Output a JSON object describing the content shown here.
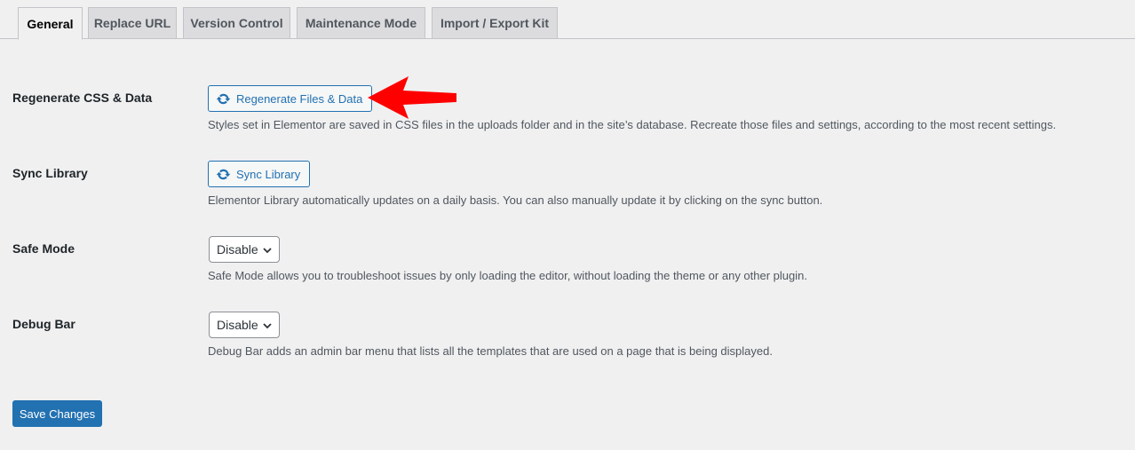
{
  "tabs": [
    {
      "label": "General",
      "active": true
    },
    {
      "label": "Replace URL"
    },
    {
      "label": "Version Control"
    },
    {
      "label": "Maintenance Mode"
    },
    {
      "label": "Import / Export Kit"
    }
  ],
  "settings": {
    "regenerate": {
      "label": "Regenerate CSS & Data",
      "button": "Regenerate Files & Data",
      "icon": "refresh-icon",
      "description": "Styles set in Elementor are saved in CSS files in the uploads folder and in the site’s database. Recreate those files and settings, according to the most recent settings."
    },
    "sync": {
      "label": "Sync Library",
      "button": "Sync Library",
      "icon": "refresh-icon",
      "description": "Elementor Library automatically updates on a daily basis. You can also manually update it by clicking on the sync button."
    },
    "safe_mode": {
      "label": "Safe Mode",
      "value": "Disable",
      "description": "Safe Mode allows you to troubleshoot issues by only loading the editor, without loading the theme or any other plugin."
    },
    "debug_bar": {
      "label": "Debug Bar",
      "value": "Disable",
      "description": "Debug Bar adds an admin bar menu that lists all the templates that are used on a page that is being displayed."
    }
  },
  "save_button": "Save Changes",
  "colors": {
    "accent": "#2271b1",
    "annotation_arrow": "#ff0000",
    "background": "#f0f0f1"
  }
}
